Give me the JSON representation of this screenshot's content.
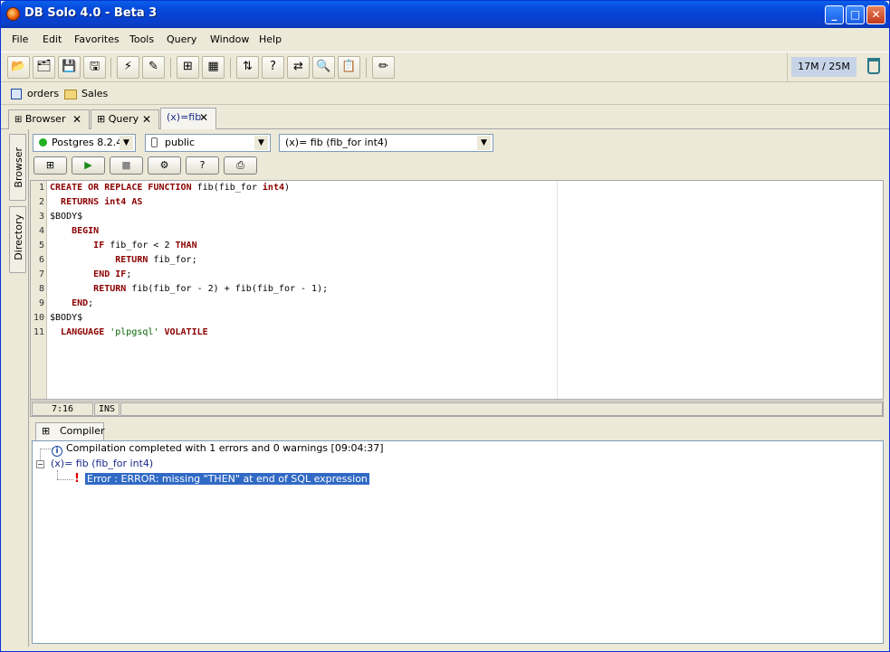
{
  "window": {
    "title": "DB Solo  4.0 - Beta 3"
  },
  "menu": [
    "File",
    "Edit",
    "Favorites",
    "Tools",
    "Query",
    "Window",
    "Help"
  ],
  "memory": "17M / 25M",
  "favorites": [
    {
      "label": "orders",
      "icon": "table-icon"
    },
    {
      "label": "Sales",
      "icon": "folder-icon"
    }
  ],
  "tabs": [
    {
      "label": "Browser",
      "icon": "browser-icon"
    },
    {
      "label": "Query",
      "icon": "grid-icon"
    },
    {
      "label": "(x)=fib",
      "icon": "function-icon"
    }
  ],
  "sidebar_tabs": [
    "Browser",
    "Directory"
  ],
  "selectors": {
    "server": "Postgres 8.2.4",
    "schema": "public",
    "function": "(x)= fib (fib_for int4)"
  },
  "code_lines": [
    "CREATE OR REPLACE FUNCTION fib(fib_for int4)",
    "  RETURNS int4 AS",
    "$BODY$",
    "    BEGIN",
    "        IF fib_for < 2 THAN",
    "            RETURN fib_for;",
    "        END IF;",
    "        RETURN fib(fib_for - 2) + fib(fib_for - 1);",
    "    END;",
    "$BODY$",
    "  LANGUAGE 'plpgsql' VOLATILE"
  ],
  "line_numbers": [
    "1",
    "2",
    "3",
    "4",
    "5",
    "6",
    "7",
    "8",
    "9",
    "10",
    "11"
  ],
  "status": {
    "position": "7:16",
    "mode": "INS"
  },
  "compiler": {
    "tab_label": "Compiler",
    "summary": "Compilation completed with 1 errors and 0 warnings [09:04:37]",
    "function_node": "(x)= fib (fib_for int4)",
    "error": "Error : ERROR: missing \"THEN\" at end of SQL expression"
  },
  "colors": {
    "keyword": "#8b0000",
    "string": "#006400",
    "selection": "#316ac5",
    "titlebar": "#0544d8"
  }
}
